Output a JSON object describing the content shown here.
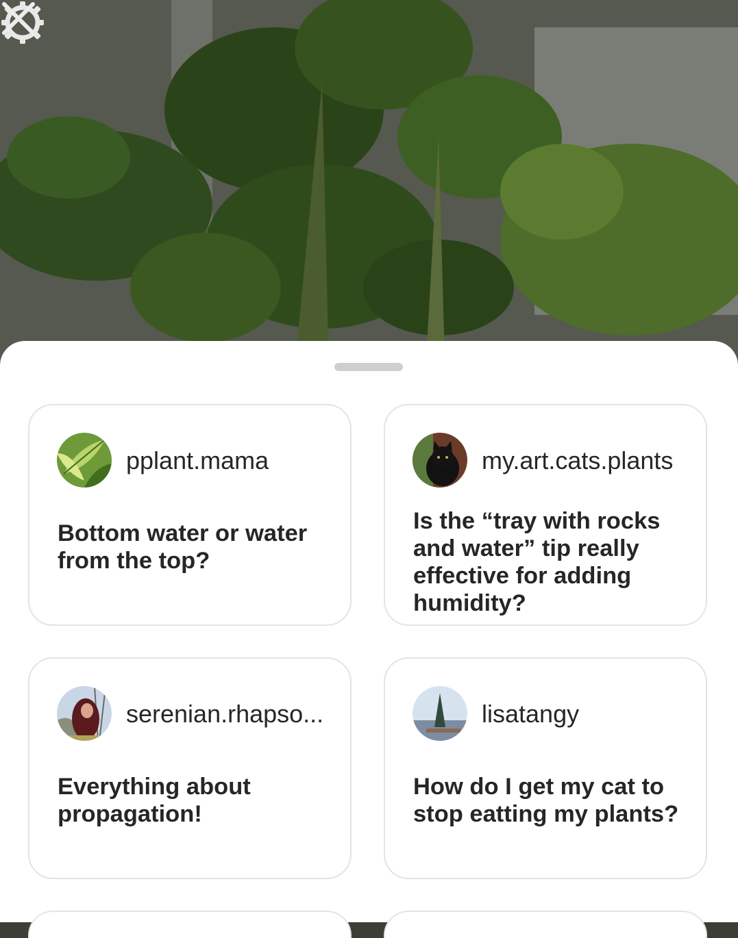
{
  "background": {
    "description_icon_left": "gear-icon",
    "description_icon_right": "close-icon"
  },
  "sheet": {
    "cards": [
      {
        "username": "pplant.mama",
        "question": "Bottom water or water from the top?",
        "avatar_icon": "leaf-avatar"
      },
      {
        "username": "my.art.cats.plants",
        "question": "Is the “tray with rocks and water” tip really effective for adding humidity?",
        "avatar_icon": "cat-avatar"
      },
      {
        "username": "serenian.rhapso...",
        "question": "Everything about propagation!",
        "avatar_icon": "person-avatar"
      },
      {
        "username": "lisatangy",
        "question": "How do I get my cat to stop eatting my plants?",
        "avatar_icon": "sky-avatar"
      }
    ]
  },
  "colors": {
    "text": "#262626",
    "card_border": "#e4e4e4",
    "sheet_bg": "#ffffff"
  }
}
